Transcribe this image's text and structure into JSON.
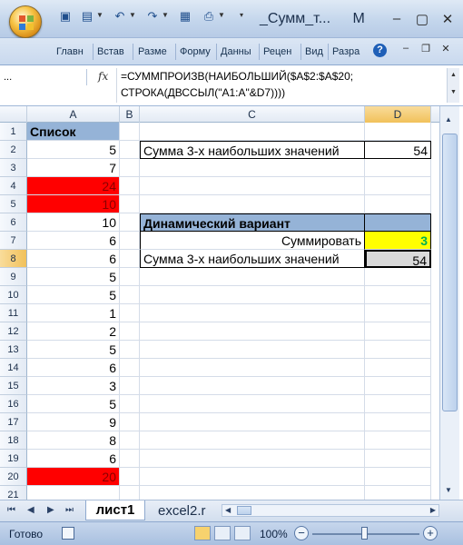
{
  "window": {
    "title": "_Сумм_т...",
    "app_badge": "M"
  },
  "ribbon": {
    "tabs": [
      "Главн",
      "Встав",
      "Разме",
      "Форму",
      "Данны",
      "Рецен",
      "Вид",
      "Разра"
    ]
  },
  "formula_bar": {
    "name_box": "...",
    "fx_label": "fx",
    "formula": "=СУММПРОИЗВ(НАИБОЛЬШИЙ($A$2:$A$20;\nСТРОКА(ДВССЫЛ(\"A1:A\"&D7))))"
  },
  "columns": [
    "A",
    "B",
    "C",
    "D"
  ],
  "active_column": "D",
  "active_row": 8,
  "rows": [
    {
      "n": 1,
      "A": "Список"
    },
    {
      "n": 2,
      "A": "5",
      "C": "Сумма 3-х наибольших значений",
      "D": "54"
    },
    {
      "n": 3,
      "A": "7"
    },
    {
      "n": 4,
      "A": "24",
      "A_red": true
    },
    {
      "n": 5,
      "A": "10",
      "A_red": true
    },
    {
      "n": 6,
      "A": "10",
      "C": "Динамический вариант"
    },
    {
      "n": 7,
      "A": "6",
      "C": "Суммировать",
      "D": "3"
    },
    {
      "n": 8,
      "A": "6",
      "C": "Сумма 3-х наибольших значений",
      "D": "54"
    },
    {
      "n": 9,
      "A": "5"
    },
    {
      "n": 10,
      "A": "5"
    },
    {
      "n": 11,
      "A": "1"
    },
    {
      "n": 12,
      "A": "2"
    },
    {
      "n": 13,
      "A": "5"
    },
    {
      "n": 14,
      "A": "6"
    },
    {
      "n": 15,
      "A": "3"
    },
    {
      "n": 16,
      "A": "5"
    },
    {
      "n": 17,
      "A": "9"
    },
    {
      "n": 18,
      "A": "8"
    },
    {
      "n": 19,
      "A": "6"
    },
    {
      "n": 20,
      "A": "20",
      "A_red": true
    },
    {
      "n": 21,
      "A": ""
    }
  ],
  "sheet_tabs": {
    "active": "лист1",
    "other": "excel2.r"
  },
  "status": {
    "ready": "Готово",
    "zoom": "100%"
  },
  "colors": {
    "header_blue": "#95b3d7",
    "highlight_red": "#ff0000",
    "highlight_yellow": "#ffff00",
    "selected_gray": "#d9d9d9",
    "green_text": "#00b050"
  }
}
